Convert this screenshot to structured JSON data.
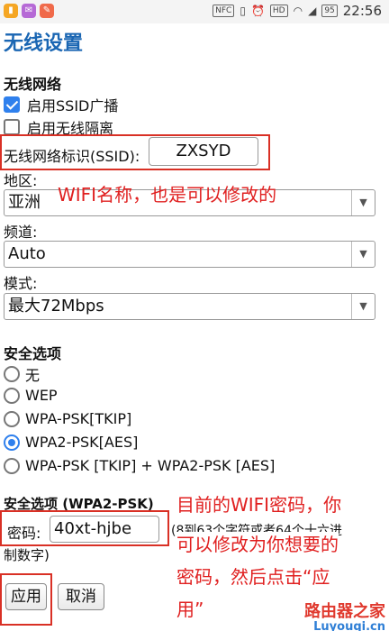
{
  "status_bar": {
    "nfc": "NFC",
    "hd": "HD",
    "battery": "95",
    "time": "22:56",
    "app_icon_colors": [
      "#f5a623",
      "#b66ad6",
      "#f06a4a"
    ]
  },
  "page_title": "无线设置",
  "wireless_section": {
    "title": "无线网络",
    "enable_ssid_broadcast": {
      "label": "启用SSID广播",
      "checked": true
    },
    "enable_isolation": {
      "label": "启用无线隔离",
      "checked": false
    },
    "ssid_label": "无线网络标识(SSID):",
    "ssid_value": "ZXSYD",
    "region_label": "地区:",
    "region_value": "亚洲",
    "channel_label": "频道:",
    "channel_value": "Auto",
    "mode_label": "模式:",
    "mode_value": "最大72Mbps"
  },
  "security_section": {
    "title": "安全选项",
    "options": [
      {
        "label": "无",
        "selected": false
      },
      {
        "label": "WEP",
        "selected": false
      },
      {
        "label": "WPA-PSK[TKIP]",
        "selected": false
      },
      {
        "label": "WPA2-PSK[AES]",
        "selected": true
      },
      {
        "label": "WPA-PSK [TKIP] + WPA2-PSK [AES]",
        "selected": false
      }
    ]
  },
  "wpa2_section": {
    "title": "安全选项 (WPA2-PSK)",
    "password_label": "密码:",
    "password_value": "40xt-hjbe",
    "hint_line1": "(8到63个字符或者64个十六进",
    "hint_line2": "制数字)"
  },
  "buttons": {
    "apply": "应用",
    "cancel": "取消"
  },
  "annotations": {
    "ssid_note": "WIFI名称，也是可以修改的",
    "password_note_1": "目前的WIFI密码，你",
    "password_note_2": "可以修改为你想要的",
    "password_note_3": "密码，然后点击“应",
    "password_note_4": "用”",
    "color": "#e02020"
  },
  "watermark": {
    "cn": "路由器之家",
    "en": "Luyouqi.cn"
  },
  "accent_color": "#2f80ed"
}
